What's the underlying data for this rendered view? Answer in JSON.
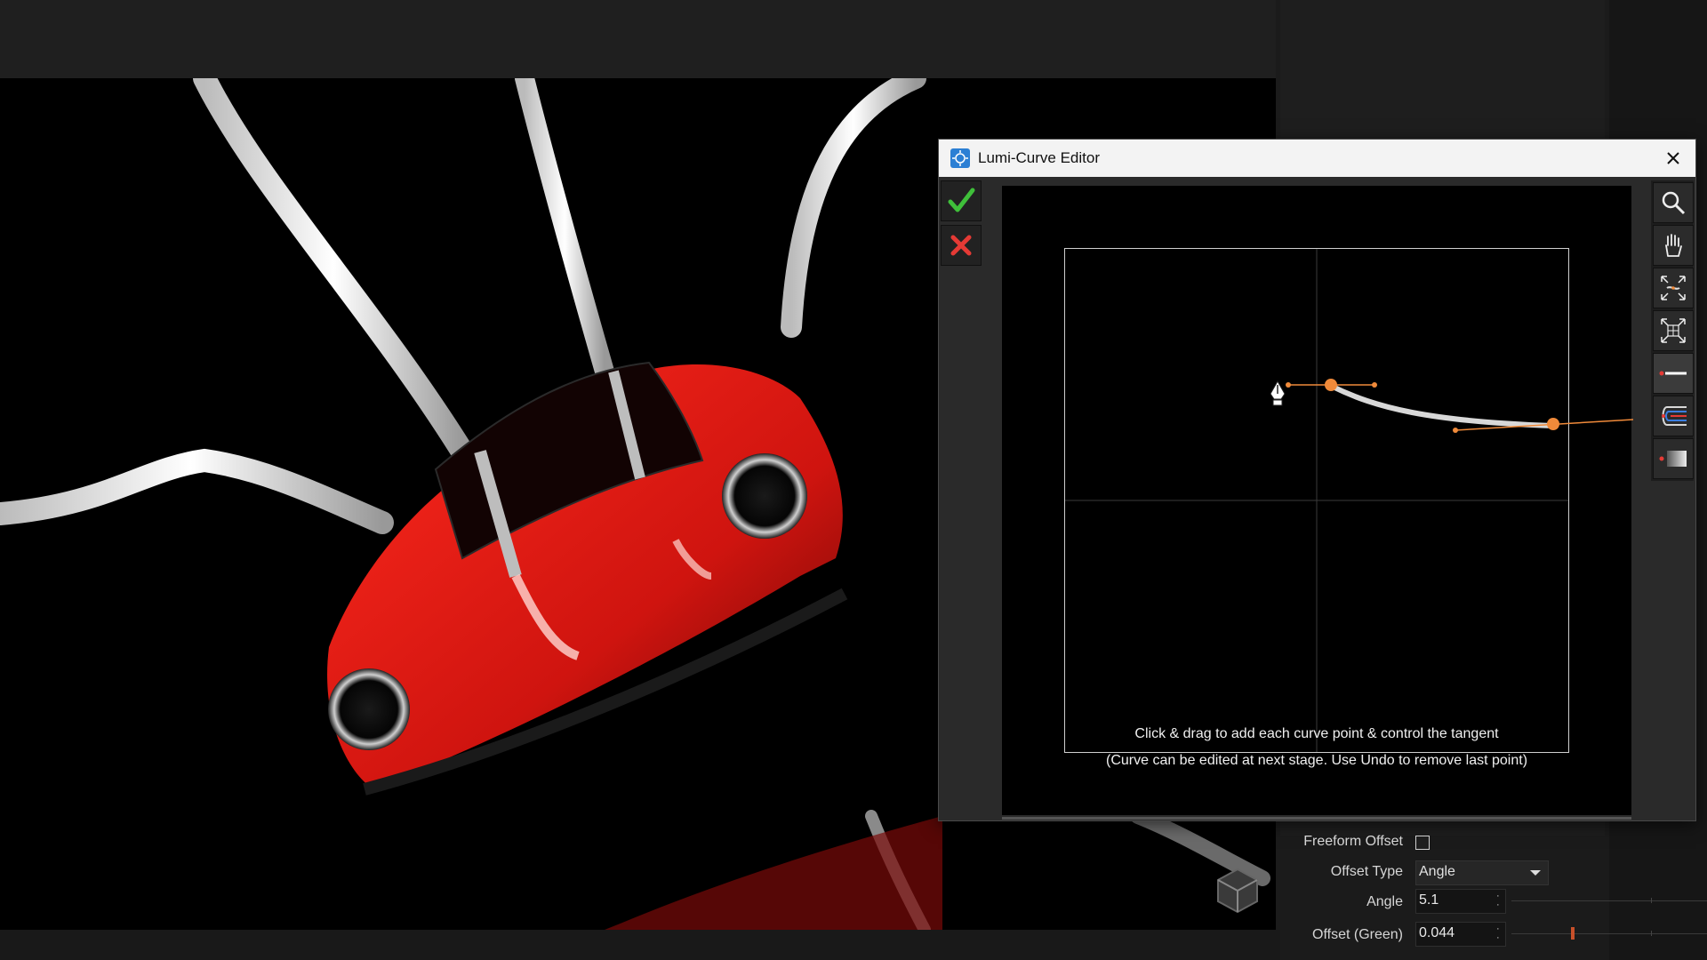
{
  "dialog": {
    "title": "Lumi-Curve Editor",
    "hint_line1": "Click & drag to add each curve point & control the tangent",
    "hint_line2": "(Curve can be edited at next stage. Use Undo to remove last point)"
  },
  "toolbar": {
    "accept_icon": "checkmark-icon",
    "cancel_icon": "x-icon"
  },
  "side_tools": [
    "zoom-icon",
    "hand-pan-icon",
    "fit-curve-icon",
    "fit-grid-icon",
    "line-point-icon",
    "color-curves-icon",
    "gradient-point-icon"
  ],
  "properties": {
    "freeform_offset_label": "Freeform Offset",
    "freeform_offset_checked": false,
    "offset_type_label": "Offset Type",
    "offset_type_value": "Angle",
    "angle_label": "Angle",
    "angle_value": "5.1",
    "offset_green_label": "Offset (Green)",
    "offset_green_value": "0.044"
  },
  "colors": {
    "accent_orange": "#f08a3a",
    "accept_green": "#3fbf3a",
    "cancel_red": "#e53a35",
    "car_red": "#d61a16"
  }
}
